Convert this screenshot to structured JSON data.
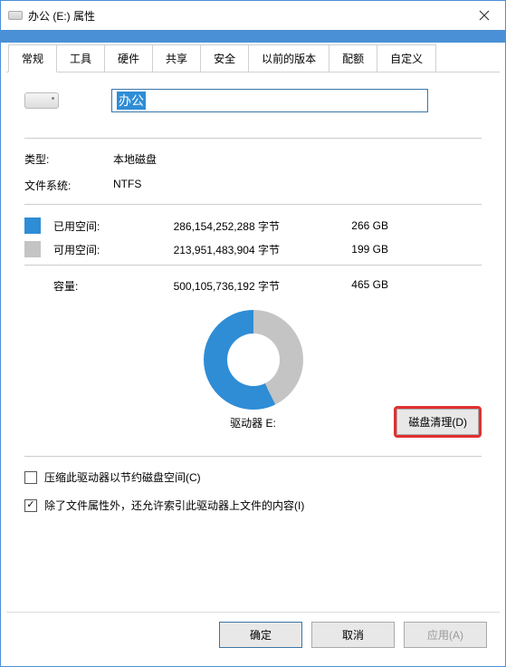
{
  "window": {
    "title": "办公 (E:) 属性"
  },
  "tabs": [
    {
      "label": "常规",
      "active": true
    },
    {
      "label": "工具"
    },
    {
      "label": "硬件"
    },
    {
      "label": "共享"
    },
    {
      "label": "安全"
    },
    {
      "label": "以前的版本"
    },
    {
      "label": "配额"
    },
    {
      "label": "自定义"
    }
  ],
  "general": {
    "drive_name": "办公",
    "type_label": "类型:",
    "type_value": "本地磁盘",
    "fs_label": "文件系统:",
    "fs_value": "NTFS",
    "used_label": "已用空间:",
    "used_bytes": "286,154,252,288 字节",
    "used_human": "266 GB",
    "free_label": "可用空间:",
    "free_bytes": "213,951,483,904 字节",
    "free_human": "199 GB",
    "capacity_label": "容量:",
    "capacity_bytes": "500,105,736,192 字节",
    "capacity_human": "465 GB",
    "drive_letter": "驱动器 E:",
    "cleanup_button": "磁盘清理(D)",
    "compress_label": "压缩此驱动器以节约磁盘空间(C)",
    "index_label": "除了文件属性外，还允许索引此驱动器上文件的内容(I)"
  },
  "buttons": {
    "ok": "确定",
    "cancel": "取消",
    "apply": "应用(A)"
  },
  "colors": {
    "used": "#2f8dd6",
    "free": "#c4c4c4",
    "border": "#4a90d6",
    "highlight": "#e03030"
  },
  "chart_data": {
    "type": "pie",
    "title": "驱动器 E:",
    "series": [
      {
        "name": "已用空间",
        "value": 266,
        "unit": "GB",
        "color": "#2f8dd6"
      },
      {
        "name": "可用空间",
        "value": 199,
        "unit": "GB",
        "color": "#c4c4c4"
      }
    ],
    "total": 465
  }
}
